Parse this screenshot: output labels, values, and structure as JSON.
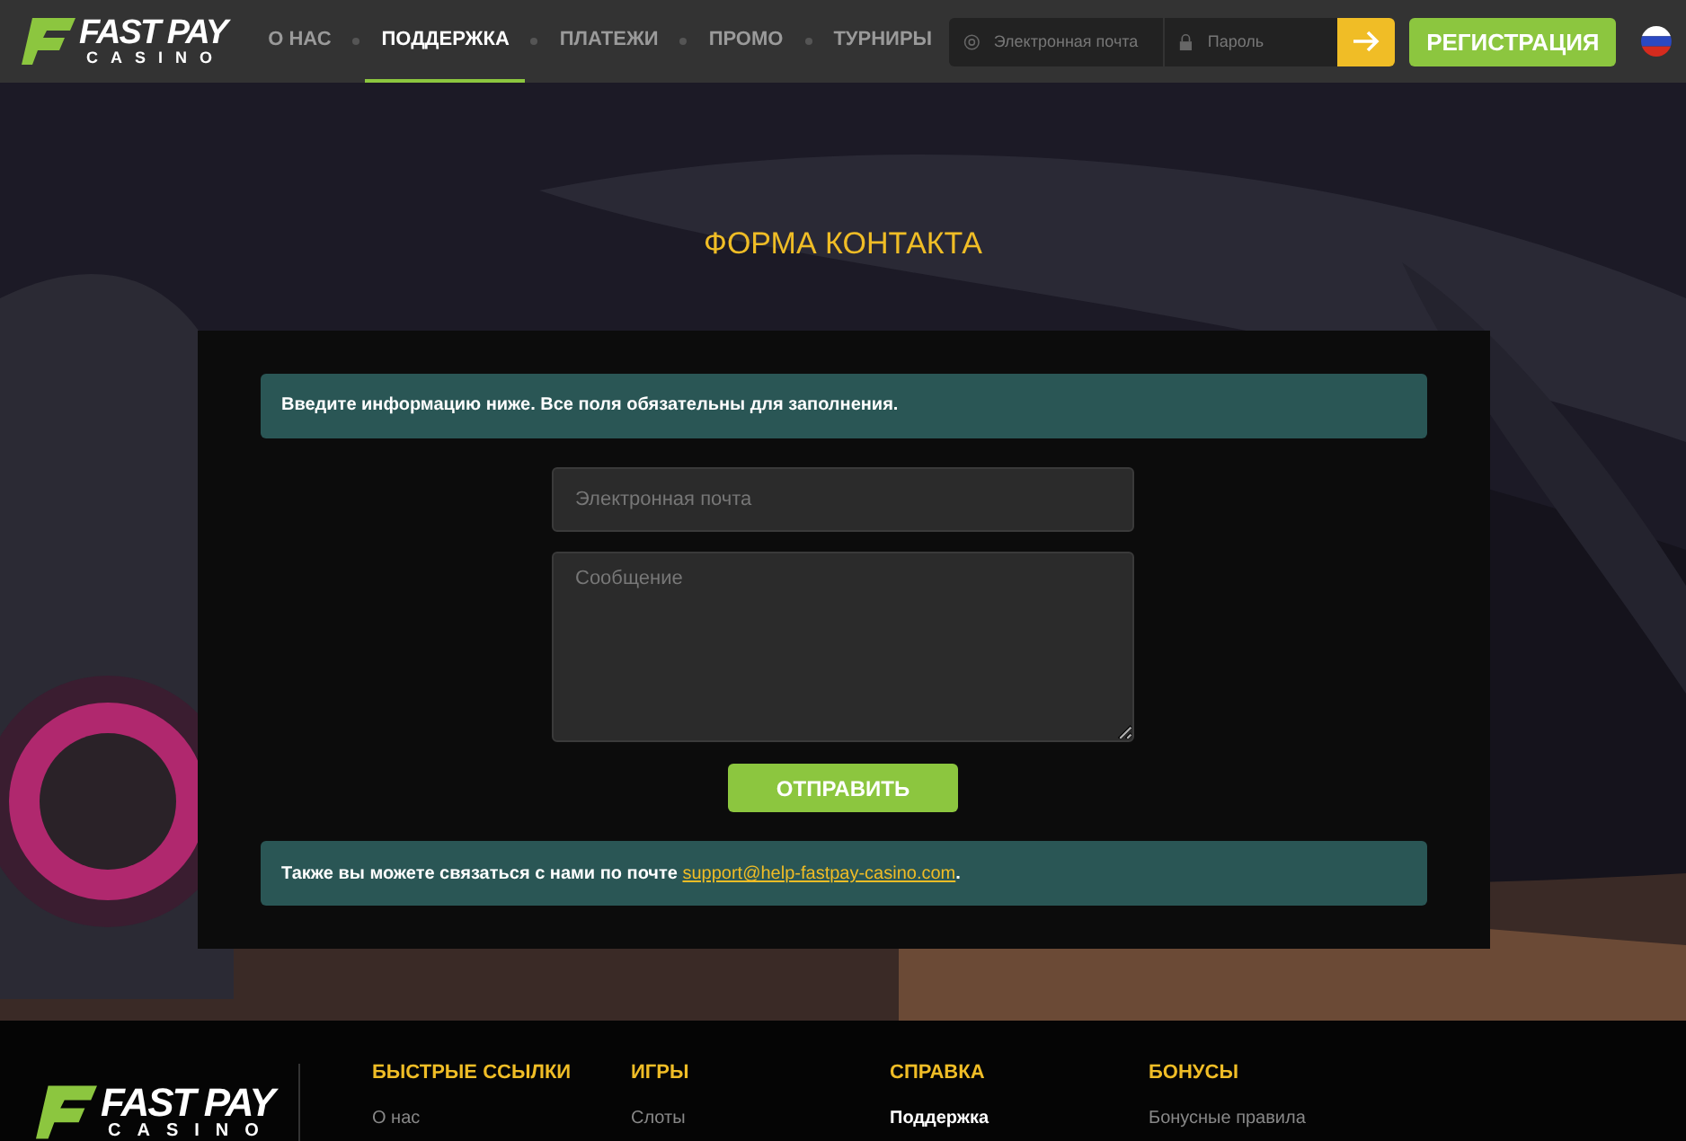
{
  "logo": {
    "top": "FAST PAY",
    "bottom": "CASINO"
  },
  "nav": [
    {
      "label": "О НАС",
      "selected": false
    },
    {
      "label": "ПОДДЕРЖКА",
      "selected": true
    },
    {
      "label": "ПЛАТЕЖИ",
      "selected": false
    },
    {
      "label": "ПРОМО",
      "selected": false
    },
    {
      "label": "ТУРНИРЫ",
      "selected": false
    }
  ],
  "login": {
    "email_placeholder": "Электронная почта",
    "password_placeholder": "Пароль"
  },
  "register_button": "РЕГИСТРАЦИЯ",
  "title": "ФОРМА КОНТАКТА",
  "info": "Введите информацию ниже. Все поля обязательны для заполнения.",
  "form": {
    "email_placeholder": "Электронная почта",
    "message_placeholder": "Сообщение",
    "submit": "ОТПРАВИТЬ"
  },
  "contact": {
    "before": "Также вы можете связаться с нами по почте ",
    "link": "support@help-fastpay-casino.com",
    "after": "."
  },
  "footer": {
    "logo": {
      "top": "FAST PAY",
      "bottom": "CASINO"
    },
    "columns": [
      {
        "title": "БЫСТРЫЕ ССЫЛКИ",
        "items": [
          {
            "label": "О нас",
            "selected": false
          }
        ]
      },
      {
        "title": "ИГРЫ",
        "items": [
          {
            "label": "Слоты",
            "selected": false
          }
        ]
      },
      {
        "title": "СПРАВКА",
        "items": [
          {
            "label": "Поддержка",
            "selected": true
          }
        ]
      },
      {
        "title": "БОНУСЫ",
        "items": [
          {
            "label": "Бонусные правила",
            "selected": false
          }
        ]
      }
    ]
  }
}
